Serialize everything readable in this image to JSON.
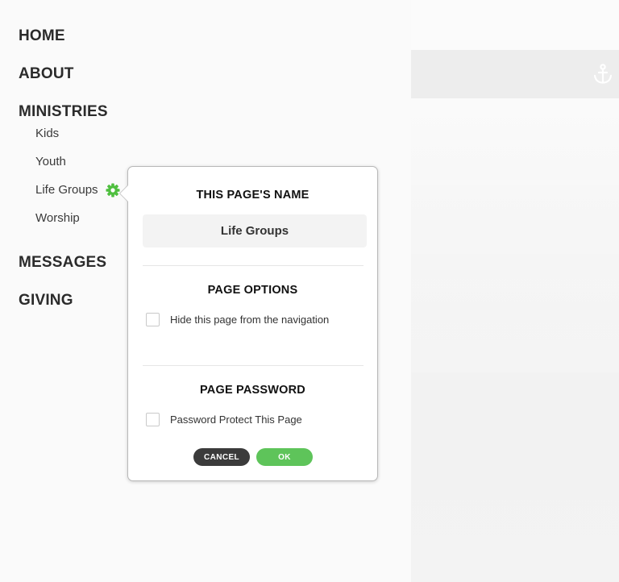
{
  "nav": {
    "items": [
      {
        "label": "HOME"
      },
      {
        "label": "ABOUT"
      },
      {
        "label": "MINISTRIES"
      },
      {
        "label": "MESSAGES"
      },
      {
        "label": "GIVING"
      }
    ],
    "sub_items": [
      {
        "label": "Kids"
      },
      {
        "label": "Youth"
      },
      {
        "label": "Life Groups"
      },
      {
        "label": "Worship"
      }
    ]
  },
  "popover": {
    "name_title": "THIS PAGE'S NAME",
    "name_value": "Life Groups",
    "options_title": "PAGE OPTIONS",
    "hide_label": "Hide this page from the navigation",
    "password_title": "PAGE PASSWORD",
    "password_label": "Password Protect This Page",
    "cancel_label": "CANCEL",
    "ok_label": "OK"
  },
  "colors": {
    "accent_green": "#5ec45a",
    "dark_button": "#3b3b3b",
    "gear_green": "#4fbf3f"
  },
  "icons": [
    "gear-icon",
    "anchor-icon"
  ]
}
